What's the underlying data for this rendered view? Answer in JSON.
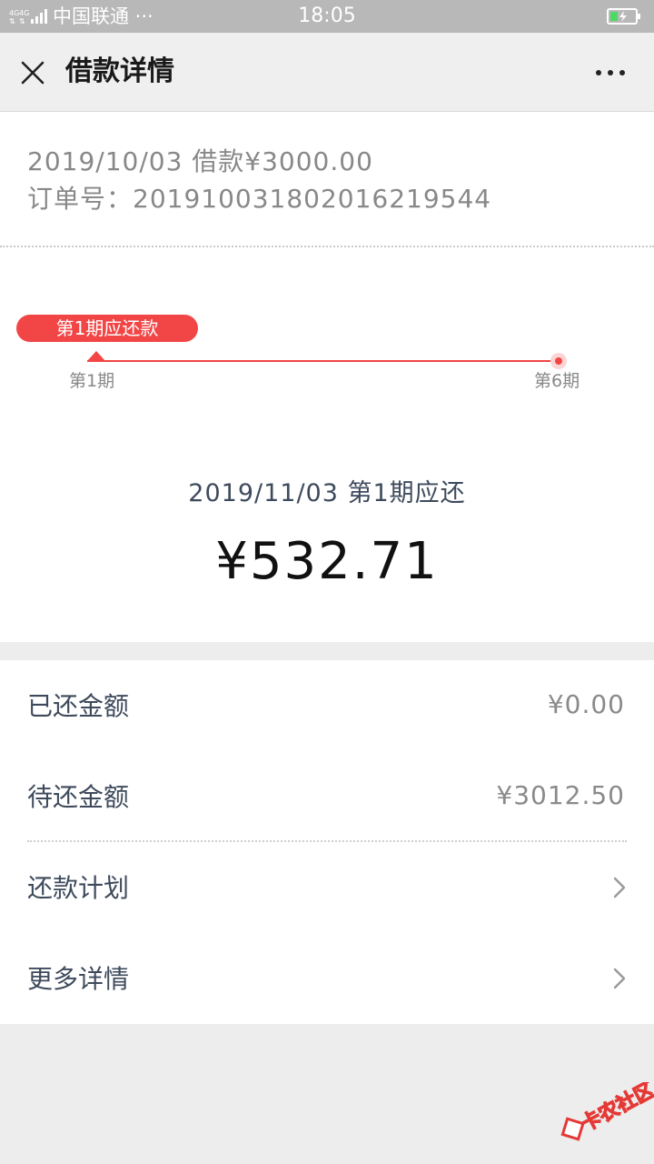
{
  "status_bar": {
    "carrier": "中国联通 ···",
    "time": "18:05"
  },
  "nav": {
    "title": "借款详情"
  },
  "loan": {
    "summary": "2019/10/03 借款¥3000.00",
    "order_no": "订单号：201910031802016219544"
  },
  "timeline": {
    "current_pill": "第1期应还款",
    "start_label": "第1期",
    "end_label": "第6期"
  },
  "due": {
    "line": "2019/11/03 第1期应还",
    "amount": "¥532.71"
  },
  "list": {
    "paid_label": "已还金额",
    "paid_value": "¥0.00",
    "remaining_label": "待还金额",
    "remaining_value": "¥3012.50",
    "plan_label": "还款计划",
    "more_label": "更多详情"
  },
  "watermark": {
    "text": "卡农社区"
  },
  "colors": {
    "accent": "#f24646",
    "nav_bg": "#efefef",
    "status_bar_bg": "#b8b8b8",
    "page_bg": "#ededed"
  },
  "icons": {
    "close": "close-icon",
    "more": "more-dots-icon",
    "chevron": "chevron-right-icon",
    "battery": "battery-charging-icon",
    "signal": "signal-icon"
  }
}
